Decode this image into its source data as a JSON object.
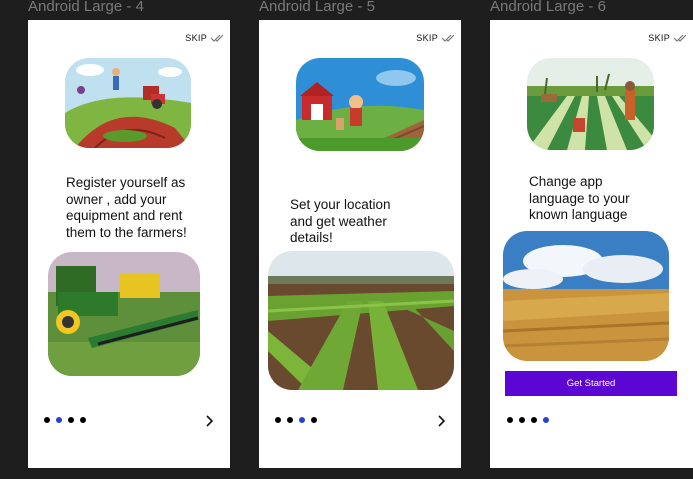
{
  "frames": [
    {
      "label": "Android Large - 4",
      "skip": "SKIP",
      "text": "Register yourself as owner , add your equipment and rent them to the farmers!",
      "active_dot": 1
    },
    {
      "label": "Android Large - 5",
      "skip": "SKIP",
      "text": "Set your location and get weather details!",
      "active_dot": 2
    },
    {
      "label": "Android Large - 6",
      "skip": "SKIP",
      "text": "Change app language to your known language",
      "cta": "Get Started",
      "active_dot": 3
    }
  ],
  "icons": {
    "skip": "double-check-icon",
    "next": "chevron-right-icon"
  },
  "colors": {
    "cta": "#5b06d2",
    "active_dot": "#2d3fd1",
    "canvas": "#1e1e1e"
  }
}
